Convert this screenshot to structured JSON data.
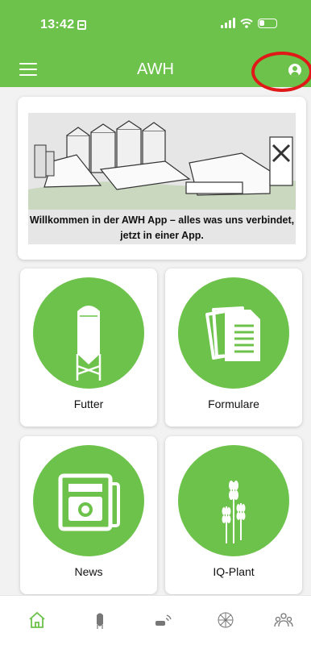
{
  "status_bar": {
    "time": "13:42"
  },
  "app_bar": {
    "title": "AWH"
  },
  "welcome": {
    "text": "Willkommen in der AWH App – alles was uns verbindet, jetzt in einer App."
  },
  "tiles": [
    {
      "label": "Futter",
      "icon": "silo-icon"
    },
    {
      "label": "Formulare",
      "icon": "documents-icon"
    },
    {
      "label": "News",
      "icon": "newspaper-camera-icon"
    },
    {
      "label": "IQ-Plant",
      "icon": "wheat-icon"
    }
  ],
  "bottom_nav": [
    {
      "icon": "home-icon",
      "active": true
    },
    {
      "icon": "silo-icon",
      "active": false
    },
    {
      "icon": "sensor-signal-icon",
      "active": false
    },
    {
      "icon": "network-icon",
      "active": false
    },
    {
      "icon": "group-icon",
      "active": false
    }
  ],
  "colors": {
    "brand": "#6cc24a",
    "highlight": "#e01818",
    "nav_active": "#6cc24a",
    "nav_inactive": "#777777"
  }
}
